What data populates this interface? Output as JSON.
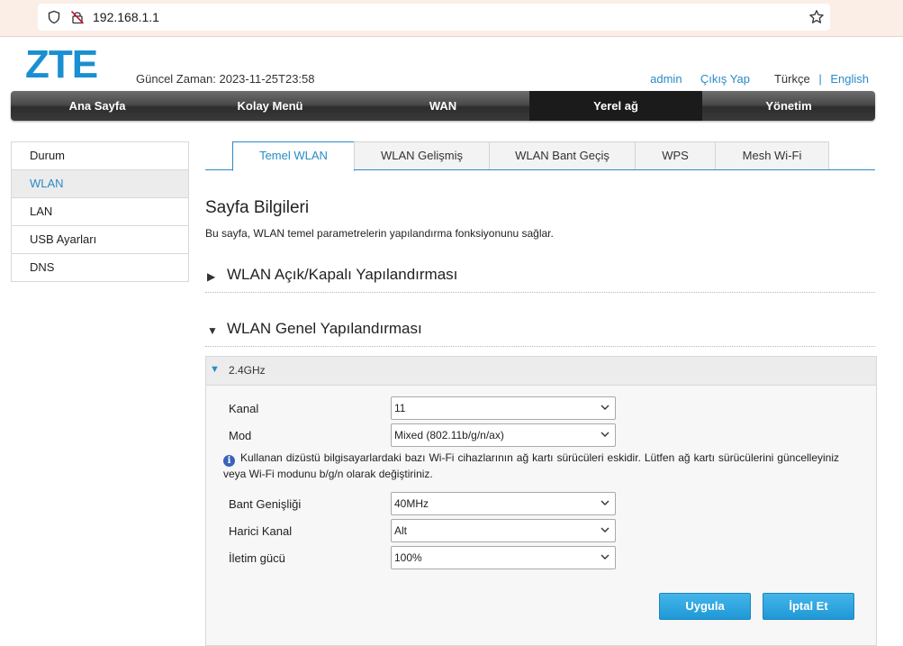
{
  "browser": {
    "url": "192.168.1.1",
    "icons": [
      "shield-icon",
      "insecure-lock-icon",
      "star-icon"
    ]
  },
  "header": {
    "logo_text": "ZTE",
    "time_label": "Güncel Zaman: 2023-11-25T23:58",
    "user": "admin",
    "logout": "Çıkış Yap",
    "lang_current": "Türkçe",
    "lang_separator": "|",
    "lang_other": "English"
  },
  "nav": {
    "items": [
      "Ana Sayfa",
      "Kolay Menü",
      "WAN",
      "Yerel ağ",
      "Yönetim"
    ],
    "active": "Yerel ağ"
  },
  "sidebar": {
    "items": [
      "Durum",
      "WLAN",
      "LAN",
      "USB Ayarları",
      "DNS"
    ],
    "active": "WLAN"
  },
  "tabs": {
    "items": [
      "Temel WLAN",
      "WLAN Gelişmiş",
      "WLAN Bant Geçiş",
      "WPS",
      "Mesh Wi-Fi"
    ],
    "active": "Temel WLAN"
  },
  "page": {
    "title": "Sayfa Bilgileri",
    "description": "Bu sayfa, WLAN temel parametrelerin yapılandırma fonksiyonunu sağlar."
  },
  "sections": {
    "onoff": {
      "title": "WLAN Açık/Kapalı Yapılandırması",
      "expanded": false
    },
    "general": {
      "title": "WLAN Genel Yapılandırması",
      "expanded": true
    }
  },
  "band_panel": {
    "title": "2.4GHz",
    "fields": {
      "kanal": {
        "label": "Kanal",
        "value": "11"
      },
      "mod": {
        "label": "Mod",
        "value": "Mixed (802.11b/g/n/ax)"
      },
      "bant": {
        "label": "Bant Genişliği",
        "value": "40MHz"
      },
      "harici": {
        "label": "Harici Kanal",
        "value": "Alt"
      },
      "guc": {
        "label": "İletim gücü",
        "value": "100%"
      }
    },
    "note": "Kullanan dizüstü bilgisayarlardaki bazı Wi-Fi cihazlarının ağ kartı sürücüleri eskidir. Lütfen ağ kartı sürücülerini güncelleyiniz veya Wi-Fi modunu b/g/n olarak değiştiriniz.",
    "buttons": {
      "apply": "Uygula",
      "cancel": "İptal Et"
    }
  },
  "colors": {
    "accent": "#2a8ac7",
    "logo": "#1a8fd1",
    "button": "#2aa4e0",
    "nav_dark": "#2d2d2d"
  }
}
